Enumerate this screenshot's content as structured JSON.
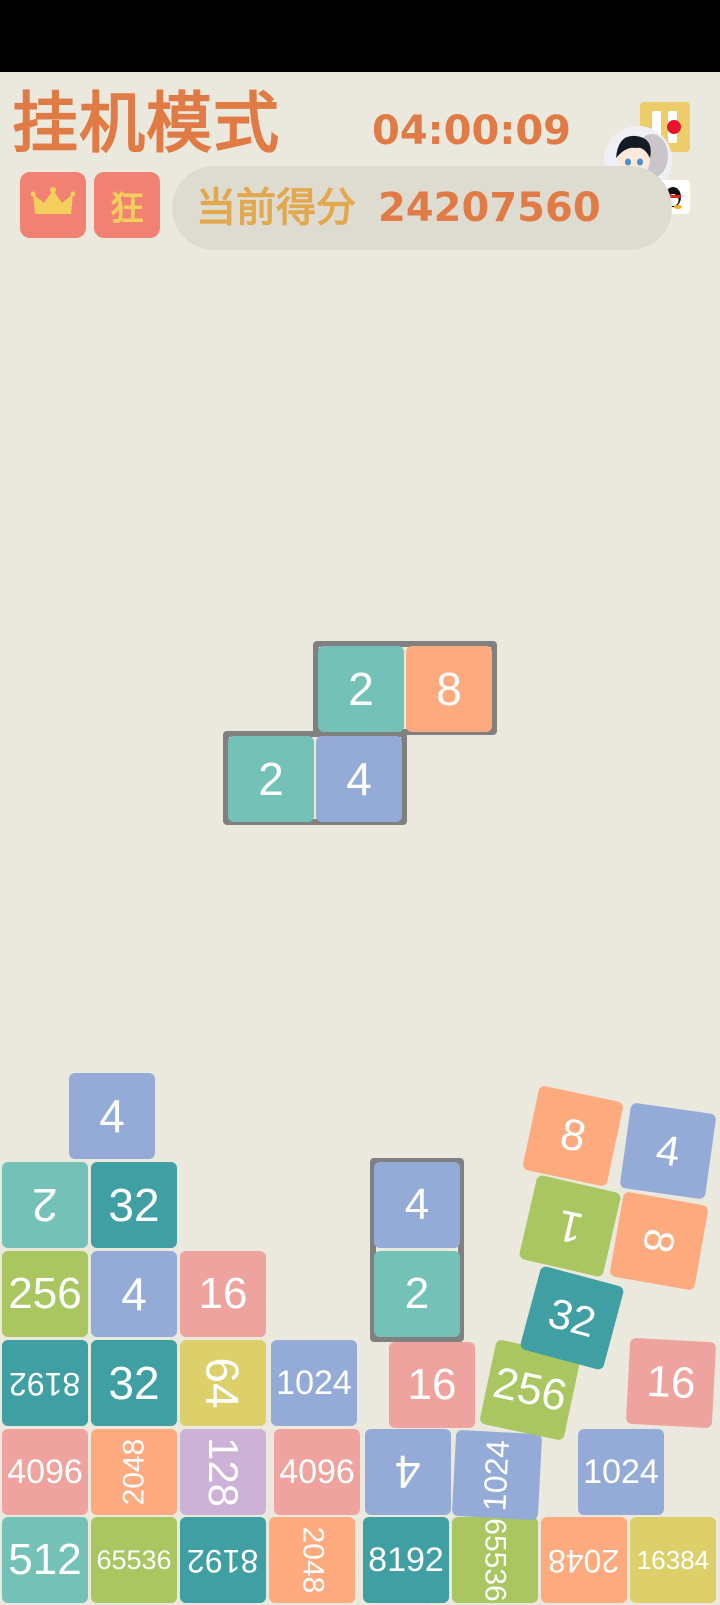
{
  "header": {
    "title": "挂机模式",
    "timer": "04:00:09",
    "crown_icon": "crown-icon",
    "rank_badge": "狂",
    "score_label": "当前得分",
    "score_value": "24207560",
    "pause_icon": "pause-icon",
    "qq_icon": "qq-penguin-icon"
  },
  "colors": {
    "background": "#ebe9de",
    "title": "#e07b45",
    "score_label": "#e2a84d",
    "badge": "#f18273",
    "tile_2": "#74c2b7",
    "tile_4": "#94abd8",
    "tile_8": "#fdaa7f",
    "tile_16": "#efa39e",
    "tile_32": "#3f9fa2",
    "tile_64": "#ddd06a",
    "tile_128": "#cbb2d6",
    "tile_256": "#a9c660",
    "tile_1024": "#94abd8",
    "tile_2048": "#fdaa7f",
    "tile_4096": "#efa39e",
    "tile_8192": "#3f9fa2",
    "tile_16384": "#ddd06a",
    "tile_65536": "#a9c660",
    "tile_1": "#a9c660"
  },
  "falling_piece": [
    "2",
    "8",
    "2",
    "4"
  ],
  "board": {
    "col1": [
      "512",
      "4096",
      "8192",
      "256",
      "2",
      "4"
    ],
    "col2": [
      "65536",
      "2048",
      "32",
      "4",
      "32"
    ],
    "col3": [
      "8192",
      "128",
      "64",
      "16"
    ],
    "col4": [
      "2048",
      "4096",
      "1024"
    ],
    "col5": [
      "8192",
      "4",
      "16",
      "2",
      "4"
    ],
    "col6": [
      "65536",
      "1024",
      "256",
      "32",
      "1",
      "8"
    ],
    "col7": [
      "2048",
      "1024",
      "16",
      "8",
      "4"
    ],
    "col8": [
      "16384"
    ]
  }
}
